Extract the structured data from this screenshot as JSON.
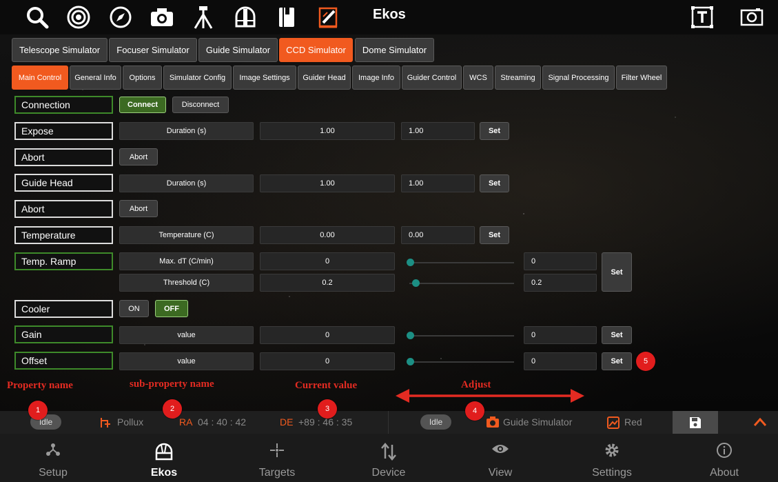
{
  "app": {
    "title": "Ekos"
  },
  "topbar": {
    "icons": [
      "search-icon",
      "target-icon",
      "compass-icon",
      "camera-icon",
      "tripod-icon",
      "dome-icon",
      "book-icon",
      "edit-icon",
      "text-icon",
      "screenshot-icon"
    ]
  },
  "device_tabs": [
    {
      "label": "Telescope Simulator",
      "active": false
    },
    {
      "label": "Focuser Simulator",
      "active": false
    },
    {
      "label": "Guide Simulator",
      "active": false
    },
    {
      "label": "CCD Simulator",
      "active": true
    },
    {
      "label": "Dome Simulator",
      "active": false
    }
  ],
  "group_tabs": [
    {
      "label": "Main Control",
      "active": true
    },
    {
      "label": "General Info"
    },
    {
      "label": "Options"
    },
    {
      "label": "Simulator Config"
    },
    {
      "label": "Image Settings"
    },
    {
      "label": "Guider Head"
    },
    {
      "label": "Image Info"
    },
    {
      "label": "Guider Control"
    },
    {
      "label": "WCS"
    },
    {
      "label": "Streaming"
    },
    {
      "label": "Signal Processing"
    },
    {
      "label": "Filter Wheel"
    }
  ],
  "properties": {
    "connection": {
      "name": "Connection",
      "connect": "Connect",
      "disconnect": "Disconnect"
    },
    "expose": {
      "name": "Expose",
      "sub": "Duration (s)",
      "current": "1.00",
      "input": "1.00",
      "set": "Set"
    },
    "abort1": {
      "name": "Abort",
      "button": "Abort"
    },
    "guide_head": {
      "name": "Guide Head",
      "sub": "Duration (s)",
      "current": "1.00",
      "input": "1.00",
      "set": "Set"
    },
    "abort2": {
      "name": "Abort",
      "button": "Abort"
    },
    "temperature": {
      "name": "Temperature",
      "sub": "Temperature (C)",
      "current": "0.00",
      "input": "0.00",
      "set": "Set"
    },
    "temp_ramp": {
      "name": "Temp. Ramp",
      "sub1": "Max. dT (C/min)",
      "current1": "0",
      "input1": "0",
      "sub2": "Threshold (C)",
      "current2": "0.2",
      "input2": "0.2",
      "set": "Set"
    },
    "cooler": {
      "name": "Cooler",
      "on": "ON",
      "off": "OFF"
    },
    "gain": {
      "name": "Gain",
      "sub": "value",
      "current": "0",
      "input": "0",
      "set": "Set"
    },
    "offset": {
      "name": "Offset",
      "sub": "value",
      "current": "0",
      "input": "0",
      "set": "Set"
    }
  },
  "annotations": {
    "property_name": "Property name",
    "sub_property_name": "sub-property name",
    "current_value": "Current value",
    "adjust": "Adjust",
    "badges": [
      "1",
      "2",
      "3",
      "4",
      "5"
    ]
  },
  "status": {
    "mount_state": "Idle",
    "target": "Pollux",
    "ra_label": "RA",
    "ra_value": "04 : 40 : 42",
    "de_label": "DE",
    "de_value": "+89 : 46 : 35",
    "camera_state": "Idle",
    "camera": "Guide Simulator",
    "filter": "Red"
  },
  "nav": {
    "items": [
      {
        "label": "Setup",
        "icon": "setup-icon"
      },
      {
        "label": "Ekos",
        "icon": "ekos-icon",
        "active": true
      },
      {
        "label": "Targets",
        "icon": "targets-icon"
      },
      {
        "label": "Device",
        "icon": "device-icon"
      },
      {
        "label": "View",
        "icon": "view-icon"
      },
      {
        "label": "Settings",
        "icon": "settings-icon"
      },
      {
        "label": "About",
        "icon": "about-icon"
      }
    ]
  },
  "colors": {
    "accent": "#f15a1f",
    "ok": "#3e8a2a",
    "annotation": "#e32b22",
    "slider": "#1c8f84"
  }
}
